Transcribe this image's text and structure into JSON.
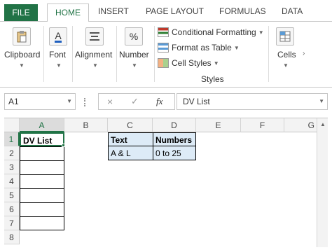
{
  "tabs": [
    "FILE",
    "HOME",
    "INSERT",
    "PAGE LAYOUT",
    "FORMULAS",
    "DATA"
  ],
  "ribbon": {
    "clipboard": "Clipboard",
    "font": "Font",
    "alignment": "Alignment",
    "number": "Number",
    "number_icon": "%",
    "font_icon": "A",
    "conditional_formatting": "Conditional Formatting",
    "format_as_table": "Format as Table",
    "cell_styles": "Cell Styles",
    "styles_group": "Styles",
    "cells": "Cells"
  },
  "formula_bar": {
    "name_box": "A1",
    "cancel": "×",
    "enter": "✓",
    "fx": "fx",
    "value": "DV List"
  },
  "grid": {
    "columns": [
      "A",
      "B",
      "C",
      "D",
      "E",
      "F",
      "G"
    ],
    "rows": [
      "1",
      "2",
      "3",
      "4",
      "5",
      "6",
      "7",
      "8"
    ],
    "a1": "DV List",
    "c1": "Text",
    "d1": "Numbers",
    "c2": "A & L",
    "d2": "0 to 25"
  },
  "colors": {
    "accent": "#217346",
    "table_header": "#ddebf7"
  }
}
